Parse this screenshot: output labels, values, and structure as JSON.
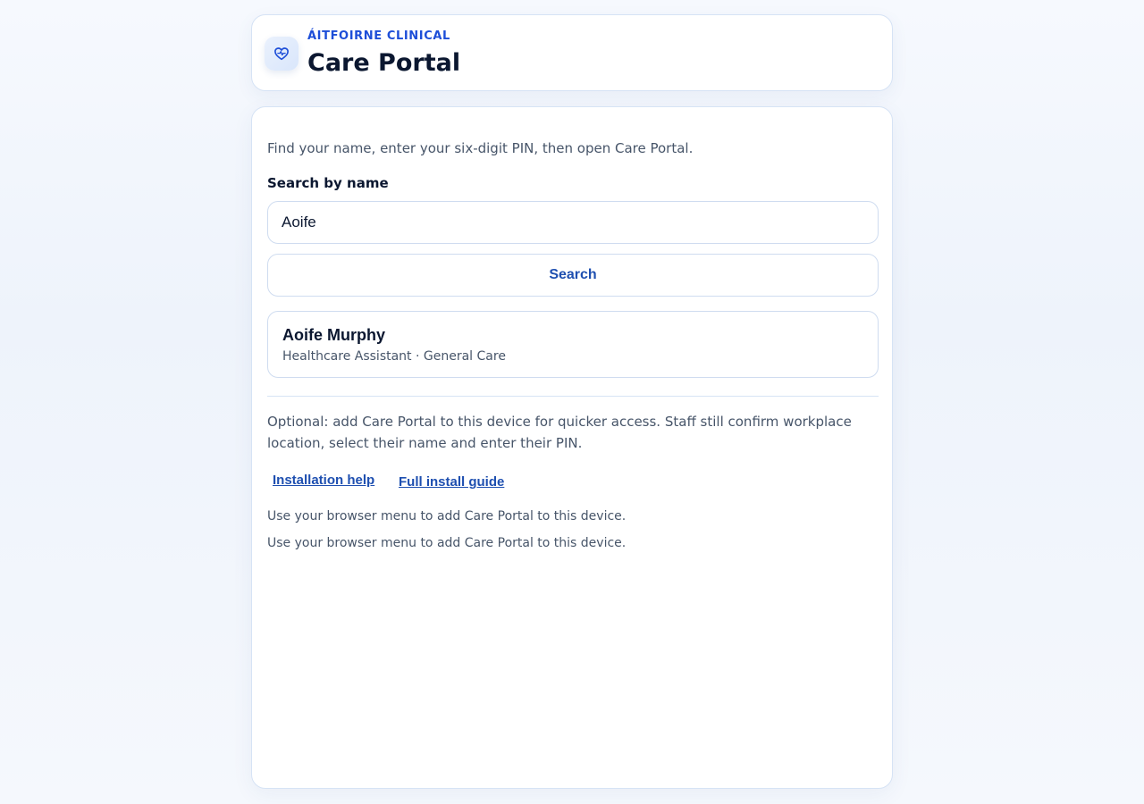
{
  "header": {
    "brand": "ÁITFOIRNE CLINICAL",
    "title": "Care Portal",
    "logo_icon": "heart-pulse-icon"
  },
  "main": {
    "intro": "Find your name, enter your six-digit PIN, then open Care Portal.",
    "search_label": "Search by name",
    "search_value": "Aoife",
    "search_button": "Search",
    "results": [
      {
        "name": "Aoife Murphy",
        "role": "Healthcare Assistant · General Care"
      }
    ],
    "install": {
      "optional_text": "Optional: add Care Portal to this device for quicker access. Staff still confirm workplace location, select their name and enter their PIN.",
      "help_link": "Installation help",
      "guide_link": "Full install guide",
      "notes": [
        "Use your browser menu to add Care Portal to this device.",
        "Use your browser menu to add Care Portal to this device."
      ]
    }
  },
  "colors": {
    "accent": "#1d4ed8",
    "link": "#1e4fb0",
    "border": "#d6e3f5",
    "text_muted": "#475569"
  }
}
